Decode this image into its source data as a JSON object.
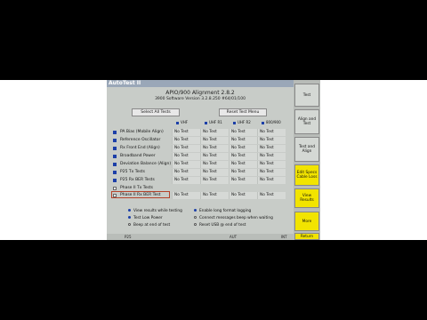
{
  "window": {
    "title": "AutoTest II"
  },
  "header": {
    "title": "APIO/900 Alignment 2.8.2",
    "version": "3900 Software Version 3.2.8.250 #64/01/100"
  },
  "toolbar": {
    "select_all": "Select All Tests",
    "reset": "Reset Test Menu"
  },
  "columns": [
    {
      "label": "VHF"
    },
    {
      "label": "UHF R1"
    },
    {
      "label": "UHF R2"
    },
    {
      "label": "800/900"
    }
  ],
  "tests": [
    {
      "label": "PA Bias (Mobile Align)",
      "checked": true,
      "cells": [
        "No Test",
        "No Test",
        "No Test",
        "No Test"
      ]
    },
    {
      "label": "Reference Oscillator",
      "checked": true,
      "cells": [
        "No Test",
        "No Test",
        "No Test",
        "No Test"
      ]
    },
    {
      "label": "Rx Front End (Align)",
      "checked": true,
      "cells": [
        "No Test",
        "No Test",
        "No Test",
        "No Test"
      ]
    },
    {
      "label": "Broadband Power",
      "checked": true,
      "cells": [
        "No Test",
        "No Test",
        "No Test",
        "No Test"
      ]
    },
    {
      "label": "Deviation Balance (Align)",
      "checked": true,
      "cells": [
        "No Test",
        "No Test",
        "No Test",
        "No Test"
      ]
    },
    {
      "label": "P25 Tx Tests",
      "checked": true,
      "cells": [
        "No Test",
        "No Test",
        "No Test",
        "No Test"
      ]
    },
    {
      "label": "P25 Rx BER Tests",
      "checked": true,
      "cells": [
        "No Test",
        "No Test",
        "No Test",
        "No Test"
      ]
    },
    {
      "label": "Phase II Tx Tests",
      "checked": false,
      "cells": [
        "",
        "",
        "",
        ""
      ]
    },
    {
      "label": "Phase II Rx BER Test",
      "checked": false,
      "cells": [
        "No Test",
        "No Test",
        "No Test",
        "No Test"
      ]
    }
  ],
  "options": [
    {
      "label": "View results while testing",
      "checked": true
    },
    {
      "label": "Enable long format logging",
      "checked": true
    },
    {
      "label": "Test Low Power",
      "checked": true
    },
    {
      "label": "Connect messages beep when waiting",
      "checked": false
    },
    {
      "label": "Beep at end of test",
      "checked": false
    },
    {
      "label": "Reset USB @ end of test",
      "checked": false
    }
  ],
  "status": {
    "left": "P25",
    "mid": "AUT",
    "right": "INT"
  },
  "sidebar": {
    "test": "Test",
    "align_test": "Align and Test",
    "test_align": "Test and Align",
    "edit_specs": "Edit Specs Cable Loss",
    "view_results": "View Results",
    "more": "More",
    "return": "Return"
  },
  "colors": {
    "accent_blue": "#1c3fa8",
    "softkey_yellow": "#f2e400",
    "title_bar": "#9aa7b8"
  }
}
